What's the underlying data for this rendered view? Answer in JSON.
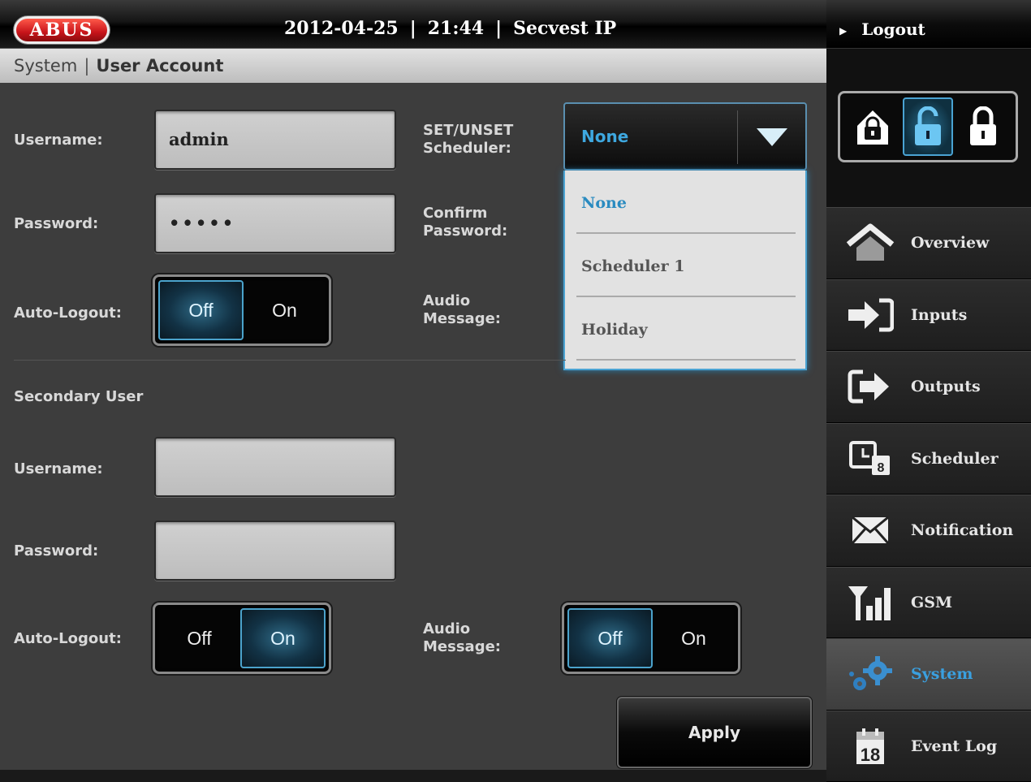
{
  "header": {
    "logo_text": "ABUS",
    "date": "2012-04-25",
    "separator": "|",
    "time": "21:44",
    "product": "Secvest IP"
  },
  "breadcrumb": {
    "section": "System",
    "separator": "|",
    "page": "User Account"
  },
  "primary_user": {
    "username_label": "Username:",
    "username_value": "admin",
    "password_label": "Password:",
    "password_value": "•••••",
    "autologout_label": "Auto-Logout:",
    "autologout": {
      "off": "Off",
      "on": "On",
      "selected": "Off"
    }
  },
  "scheduler": {
    "label_line1": "SET/UNSET",
    "label_line2": "Scheduler:",
    "selected": "None",
    "options": [
      "None",
      "Scheduler 1",
      "Holiday"
    ]
  },
  "confirm_password_label_line1": "Confirm",
  "confirm_password_label_line2": "Password:",
  "audio_label_line1": "Audio",
  "audio_label_line2": "Message:",
  "secondary_user": {
    "title": "Secondary User",
    "username_label": "Username:",
    "username_value": "",
    "password_label": "Password:",
    "password_value": "",
    "autologout_label": "Auto-Logout:",
    "autologout": {
      "off": "Off",
      "on": "On",
      "selected": "On"
    },
    "audio_label_line1": "Audio",
    "audio_label_line2": "Message:",
    "audio": {
      "off": "Off",
      "on": "On",
      "selected": "Off"
    }
  },
  "apply_label": "Apply",
  "right_panel": {
    "logout_label": "Logout",
    "arm_state": "unset",
    "nav": [
      {
        "label": "Overview",
        "icon": "home-icon",
        "active": false
      },
      {
        "label": "Inputs",
        "icon": "input-icon",
        "active": false
      },
      {
        "label": "Outputs",
        "icon": "output-icon",
        "active": false
      },
      {
        "label": "Scheduler",
        "icon": "scheduler-icon",
        "active": false
      },
      {
        "label": "Notification",
        "icon": "envelope-icon",
        "active": false
      },
      {
        "label": "GSM",
        "icon": "signal-icon",
        "active": false
      },
      {
        "label": "System",
        "icon": "gears-icon",
        "active": true
      },
      {
        "label": "Event Log",
        "icon": "calendar-icon",
        "active": false
      }
    ],
    "calendar_icon_text": "18",
    "scheduler_icon_text": "8"
  },
  "colors": {
    "accent": "#3ea8e0",
    "logo": "#c8141a"
  }
}
